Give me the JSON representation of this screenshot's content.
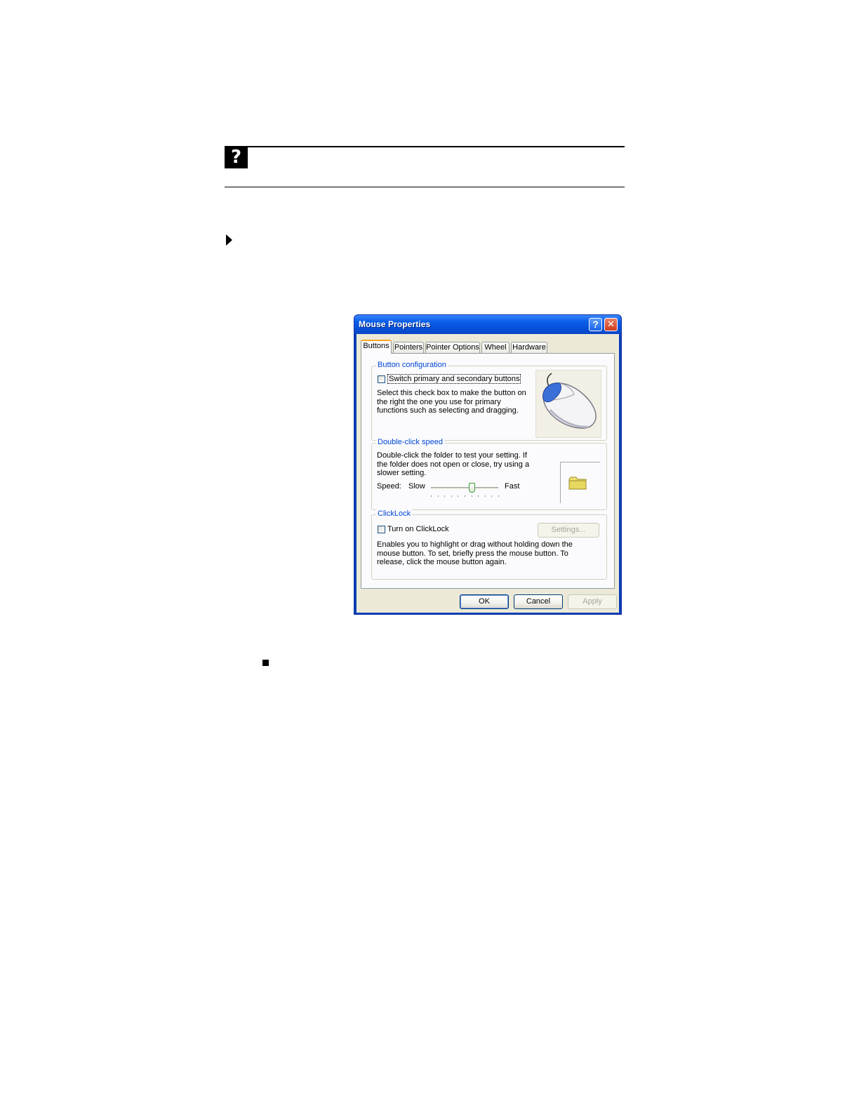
{
  "help_icon": {
    "glyph": "?",
    "icon": "question-mark-icon"
  },
  "dialog": {
    "title": "Mouse Properties",
    "help_glyph": "?",
    "close_glyph": "✕",
    "tabs": [
      "Buttons",
      "Pointers",
      "Pointer Options",
      "Wheel",
      "Hardware"
    ],
    "active_tab": "Buttons",
    "button_configuration": {
      "label": "Button configuration",
      "checkbox_label": "Switch primary and secondary buttons",
      "checked": false,
      "description": "Select this check box to make the button on the right the one you use for primary functions such as selecting and dragging."
    },
    "double_click": {
      "label": "Double-click speed",
      "description": "Double-click the folder to test your setting. If the folder does not open or close, try using a slower setting.",
      "speed_label": "Speed:",
      "slow_label": "Slow",
      "fast_label": "Fast",
      "speed_fraction": 0.6
    },
    "clicklock": {
      "label": "ClickLock",
      "checkbox_label": "Turn on ClickLock",
      "checked": false,
      "settings_button": "Settings...",
      "description": "Enables you to highlight or drag without holding down the mouse button. To set, briefly press the mouse button. To release, click the mouse button again."
    },
    "buttons": {
      "ok": "OK",
      "cancel": "Cancel",
      "apply": "Apply"
    }
  },
  "colors": {
    "title_bar": "#0a5ee8",
    "group_label": "#0046d5",
    "folder": "#f0e070",
    "mouse_accent": "#3a6fd8"
  }
}
